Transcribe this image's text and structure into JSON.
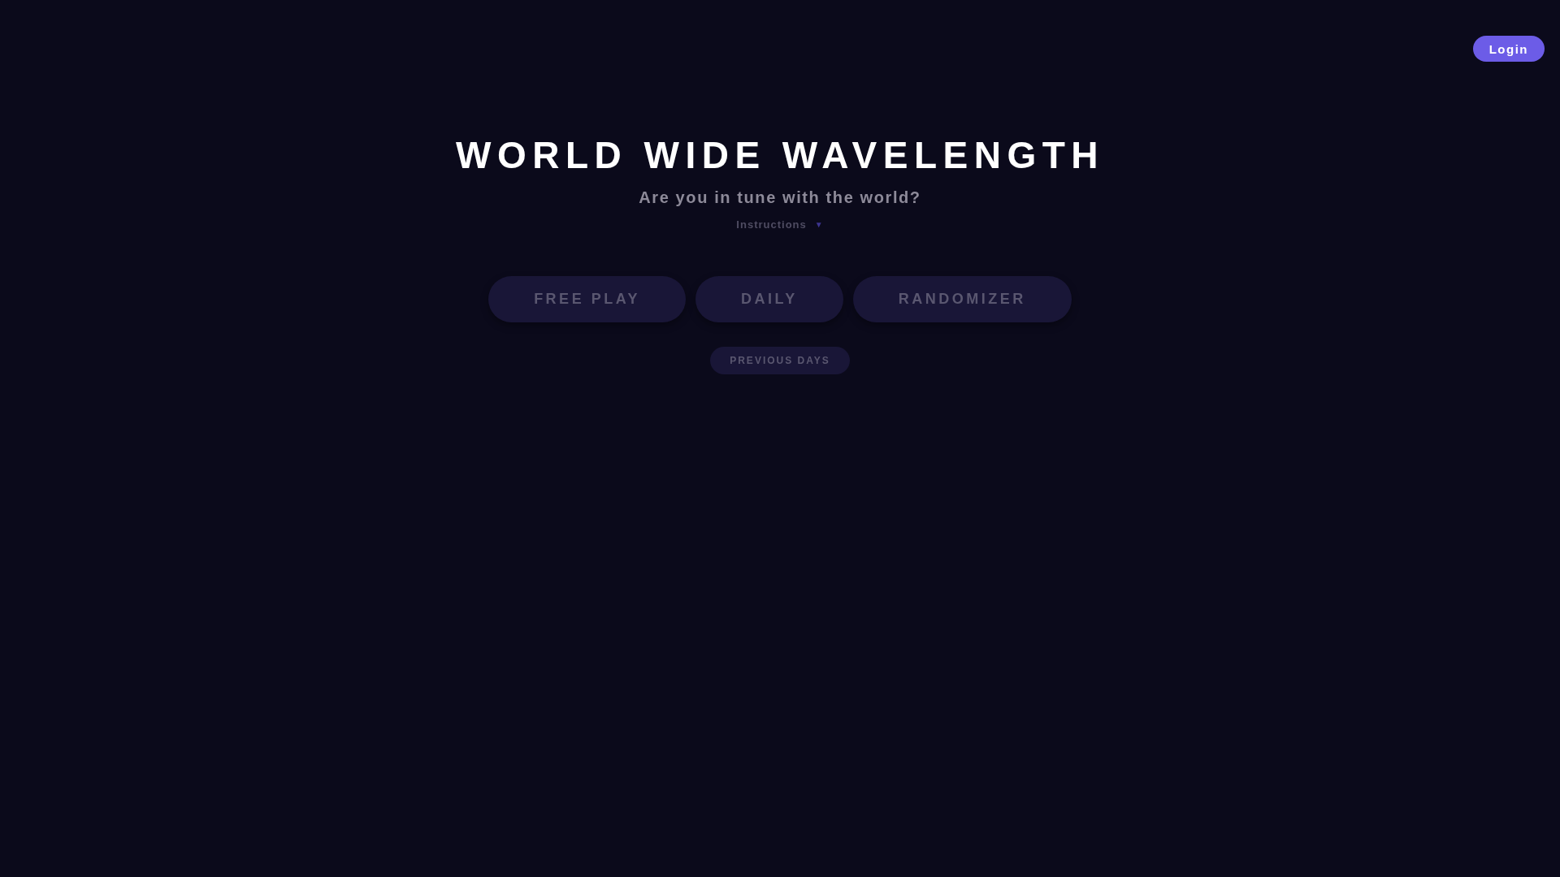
{
  "header": {
    "login_button": "Login"
  },
  "title": "WORLD WIDE WAVELENGTH",
  "subtitle": "Are you in tune with the world?",
  "instructions": {
    "label": "Instructions",
    "toggle_icon": "▼",
    "expanded": false
  },
  "modes": [
    {
      "label": "FREE PLAY",
      "disabled": true
    },
    {
      "label": "DAILY",
      "disabled": true
    },
    {
      "label": "RANDOMIZER",
      "disabled": true
    }
  ],
  "previous_days": {
    "label": "PREVIOUS DAYS",
    "disabled": true
  }
}
